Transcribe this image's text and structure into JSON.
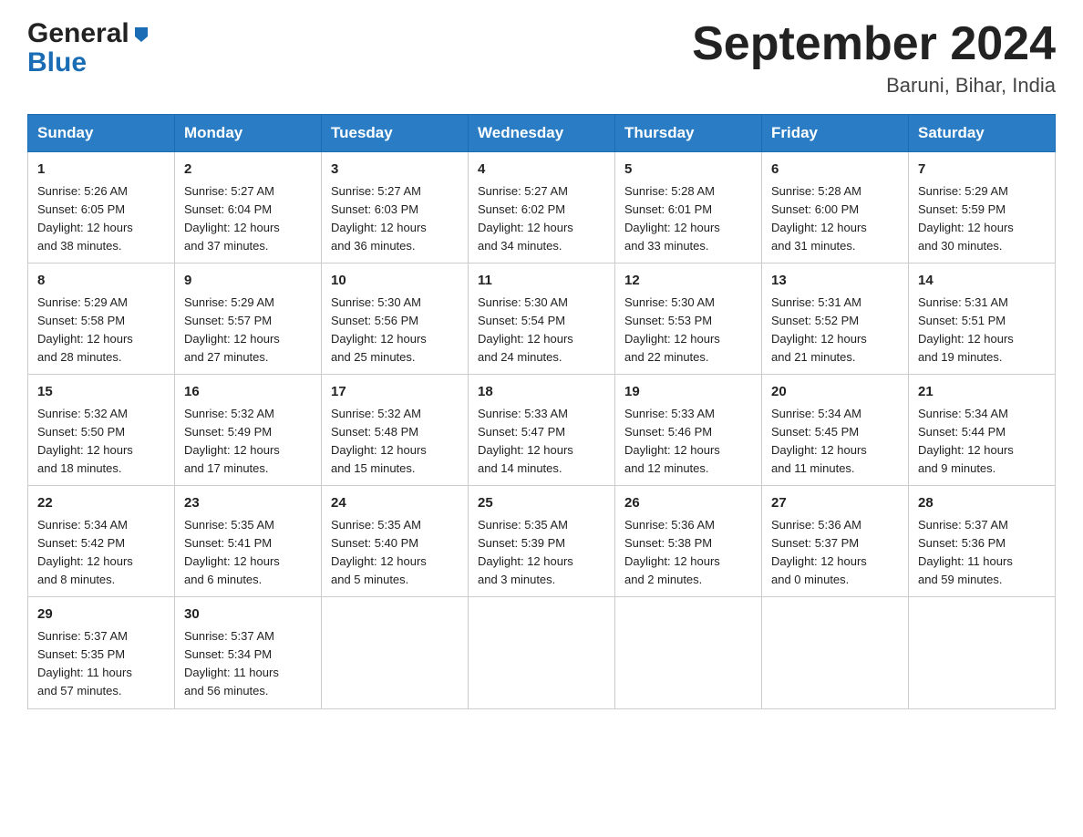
{
  "header": {
    "logo_general": "General",
    "logo_blue": "Blue",
    "title": "September 2024",
    "subtitle": "Baruni, Bihar, India"
  },
  "weekdays": [
    "Sunday",
    "Monday",
    "Tuesday",
    "Wednesday",
    "Thursday",
    "Friday",
    "Saturday"
  ],
  "weeks": [
    [
      {
        "day": "1",
        "sunrise": "5:26 AM",
        "sunset": "6:05 PM",
        "daylight": "12 hours and 38 minutes."
      },
      {
        "day": "2",
        "sunrise": "5:27 AM",
        "sunset": "6:04 PM",
        "daylight": "12 hours and 37 minutes."
      },
      {
        "day": "3",
        "sunrise": "5:27 AM",
        "sunset": "6:03 PM",
        "daylight": "12 hours and 36 minutes."
      },
      {
        "day": "4",
        "sunrise": "5:27 AM",
        "sunset": "6:02 PM",
        "daylight": "12 hours and 34 minutes."
      },
      {
        "day": "5",
        "sunrise": "5:28 AM",
        "sunset": "6:01 PM",
        "daylight": "12 hours and 33 minutes."
      },
      {
        "day": "6",
        "sunrise": "5:28 AM",
        "sunset": "6:00 PM",
        "daylight": "12 hours and 31 minutes."
      },
      {
        "day": "7",
        "sunrise": "5:29 AM",
        "sunset": "5:59 PM",
        "daylight": "12 hours and 30 minutes."
      }
    ],
    [
      {
        "day": "8",
        "sunrise": "5:29 AM",
        "sunset": "5:58 PM",
        "daylight": "12 hours and 28 minutes."
      },
      {
        "day": "9",
        "sunrise": "5:29 AM",
        "sunset": "5:57 PM",
        "daylight": "12 hours and 27 minutes."
      },
      {
        "day": "10",
        "sunrise": "5:30 AM",
        "sunset": "5:56 PM",
        "daylight": "12 hours and 25 minutes."
      },
      {
        "day": "11",
        "sunrise": "5:30 AM",
        "sunset": "5:54 PM",
        "daylight": "12 hours and 24 minutes."
      },
      {
        "day": "12",
        "sunrise": "5:30 AM",
        "sunset": "5:53 PM",
        "daylight": "12 hours and 22 minutes."
      },
      {
        "day": "13",
        "sunrise": "5:31 AM",
        "sunset": "5:52 PM",
        "daylight": "12 hours and 21 minutes."
      },
      {
        "day": "14",
        "sunrise": "5:31 AM",
        "sunset": "5:51 PM",
        "daylight": "12 hours and 19 minutes."
      }
    ],
    [
      {
        "day": "15",
        "sunrise": "5:32 AM",
        "sunset": "5:50 PM",
        "daylight": "12 hours and 18 minutes."
      },
      {
        "day": "16",
        "sunrise": "5:32 AM",
        "sunset": "5:49 PM",
        "daylight": "12 hours and 17 minutes."
      },
      {
        "day": "17",
        "sunrise": "5:32 AM",
        "sunset": "5:48 PM",
        "daylight": "12 hours and 15 minutes."
      },
      {
        "day": "18",
        "sunrise": "5:33 AM",
        "sunset": "5:47 PM",
        "daylight": "12 hours and 14 minutes."
      },
      {
        "day": "19",
        "sunrise": "5:33 AM",
        "sunset": "5:46 PM",
        "daylight": "12 hours and 12 minutes."
      },
      {
        "day": "20",
        "sunrise": "5:34 AM",
        "sunset": "5:45 PM",
        "daylight": "12 hours and 11 minutes."
      },
      {
        "day": "21",
        "sunrise": "5:34 AM",
        "sunset": "5:44 PM",
        "daylight": "12 hours and 9 minutes."
      }
    ],
    [
      {
        "day": "22",
        "sunrise": "5:34 AM",
        "sunset": "5:42 PM",
        "daylight": "12 hours and 8 minutes."
      },
      {
        "day": "23",
        "sunrise": "5:35 AM",
        "sunset": "5:41 PM",
        "daylight": "12 hours and 6 minutes."
      },
      {
        "day": "24",
        "sunrise": "5:35 AM",
        "sunset": "5:40 PM",
        "daylight": "12 hours and 5 minutes."
      },
      {
        "day": "25",
        "sunrise": "5:35 AM",
        "sunset": "5:39 PM",
        "daylight": "12 hours and 3 minutes."
      },
      {
        "day": "26",
        "sunrise": "5:36 AM",
        "sunset": "5:38 PM",
        "daylight": "12 hours and 2 minutes."
      },
      {
        "day": "27",
        "sunrise": "5:36 AM",
        "sunset": "5:37 PM",
        "daylight": "12 hours and 0 minutes."
      },
      {
        "day": "28",
        "sunrise": "5:37 AM",
        "sunset": "5:36 PM",
        "daylight": "11 hours and 59 minutes."
      }
    ],
    [
      {
        "day": "29",
        "sunrise": "5:37 AM",
        "sunset": "5:35 PM",
        "daylight": "11 hours and 57 minutes."
      },
      {
        "day": "30",
        "sunrise": "5:37 AM",
        "sunset": "5:34 PM",
        "daylight": "11 hours and 56 minutes."
      },
      null,
      null,
      null,
      null,
      null
    ]
  ],
  "labels": {
    "sunrise": "Sunrise:",
    "sunset": "Sunset:",
    "daylight": "Daylight:"
  }
}
